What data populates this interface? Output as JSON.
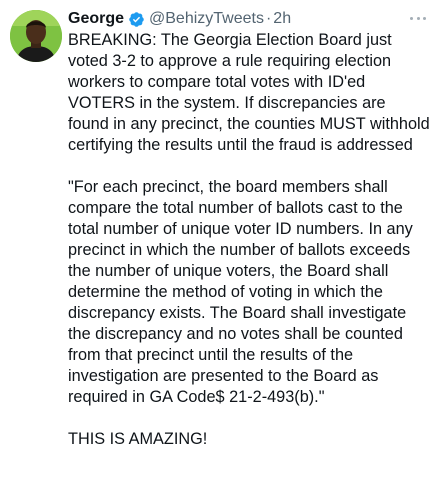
{
  "tweet": {
    "author_name": "George",
    "handle": "@BehizyTweets",
    "separator": "·",
    "time": "2h",
    "paragraphs": [
      "BREAKING: The Georgia Election Board just voted 3-2 to approve a rule requiring election workers to compare total votes with ID'ed VOTERS in the system. If discrepancies are found in any precinct, the counties MUST withhold certifying the results until the fraud is addressed",
      "\"For each precinct, the board members shall compare the total number of ballots cast to the total number of unique voter ID numbers. In any precinct in which the number of ballots exceeds the number of unique voters, the Board shall determine the method of voting in which the discrepancy exists. The Board shall investigate the discrepancy and no votes shall be counted from that precinct until the results of the investigation are presented to the Board as required in GA Code$ 21-2-493(b).\"",
      "THIS IS AMAZING!"
    ]
  },
  "icons": {
    "verified": "verified-badge-icon",
    "more": "more-options-icon"
  },
  "colors": {
    "verified_blue": "#1d9bf0",
    "muted_text": "#536471",
    "avatar_bg": "#7ec242"
  }
}
